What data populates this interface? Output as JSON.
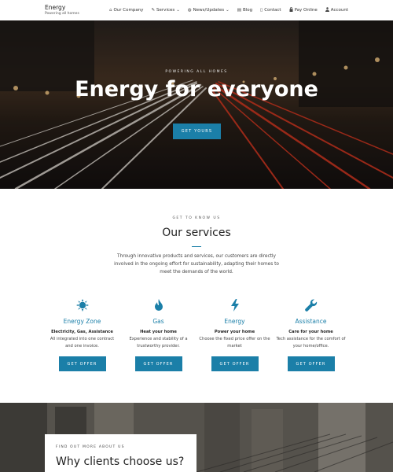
{
  "site": {
    "name": "Energy",
    "tagline": "Powering all homes"
  },
  "nav": [
    {
      "label": "Our Company",
      "icon": "building-icon",
      "glyph": "⌂"
    },
    {
      "label": "Services",
      "icon": "wrench-icon",
      "glyph": "✎",
      "caret": "⌄"
    },
    {
      "label": "News/Updates",
      "icon": "globe-icon",
      "glyph": "◍",
      "caret": "⌄"
    },
    {
      "label": "Blog",
      "icon": "blog-icon",
      "glyph": "▤"
    },
    {
      "label": "Contact",
      "icon": "phone-icon",
      "glyph": "▯"
    },
    {
      "label": "Pay Online",
      "icon": "lock-icon",
      "glyph": "🔒"
    },
    {
      "label": "Account",
      "icon": "user-icon",
      "glyph": "●"
    }
  ],
  "hero": {
    "kicker": "POWERING ALL HOMES",
    "title": "Energy for everyone",
    "button": "GET YOURS"
  },
  "services": {
    "kicker": "GET TO KNOW US",
    "title": "Our services",
    "intro": "Through innovative products and services, our customers are directly involved in the ongoing effort for sustainability, adapting their homes to meet the demands of the world.",
    "cards": [
      {
        "icon": "sun-icon",
        "title": "Energy Zone",
        "subtitle": "Electricity, Gas, Assistance",
        "desc": "All integrated into one contract and one invoice.",
        "button": "GET OFFER"
      },
      {
        "icon": "flame-icon",
        "title": "Gas",
        "subtitle": "Heat your home",
        "desc": "Experience and stability of a trustworthy provider.",
        "button": "GET OFFER"
      },
      {
        "icon": "bolt-icon",
        "title": "Energy",
        "subtitle": "Power your home",
        "desc": "Choose the fixed price offer on the market",
        "button": "GET OFFER"
      },
      {
        "icon": "wrench-icon",
        "title": "Assistance",
        "subtitle": "Care for your home",
        "desc": "Tech assistance for the comfort of your home/office.",
        "button": "GET OFFER"
      }
    ]
  },
  "why": {
    "kicker": "FIND OUT MORE ABOUT US",
    "title": "Why clients choose us?"
  },
  "colors": {
    "accent": "#1b7fa8",
    "text": "#222222"
  }
}
